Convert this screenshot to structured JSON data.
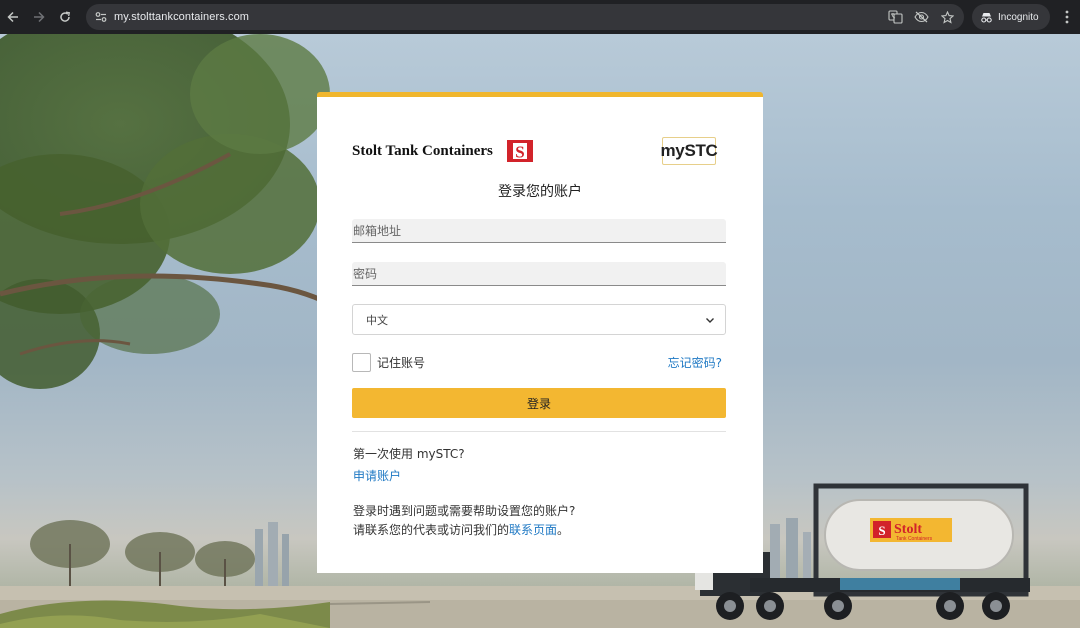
{
  "browser": {
    "url": "my.stolttankcontainers.com",
    "incognito_label": "Incognito"
  },
  "card": {
    "brand_name": "Stolt Tank Containers",
    "brand_mark_letter": "S",
    "product_logo": "mySTC",
    "heading": "登录您的账户",
    "email_placeholder": "邮箱地址",
    "password_placeholder": "密码",
    "language_value": "中文",
    "remember_label": "记住账号",
    "forgot_link": "忘记密码?",
    "login_button": "登录",
    "first_time_text": "第一次使用 mySTC?",
    "apply_link": "申请账户",
    "help_line1": "登录时遇到问题或需要帮助设置您的账户?",
    "help_line2_prefix": "请联系您的代表或访问我们的",
    "contact_link": "联系页面",
    "help_line2_suffix": "。"
  },
  "background": {
    "truck_brand": "Stolt",
    "truck_subtitle": "Tank Containers"
  },
  "colors": {
    "accent_yellow": "#f3b731",
    "link_blue": "#1f79c4",
    "stolt_red": "#d2232a"
  }
}
